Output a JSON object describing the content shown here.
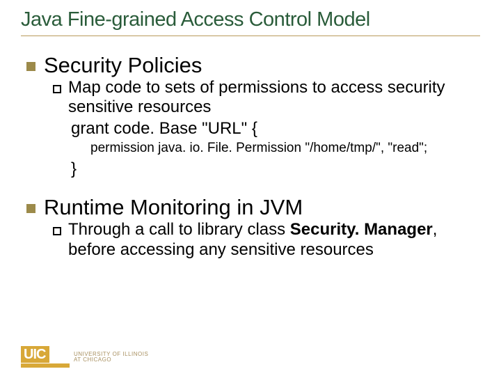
{
  "title": "Java Fine-grained Access Control Model",
  "sections": [
    {
      "heading": "Security Policies",
      "sub": {
        "text": "Map code to sets of permissions to access security sensitive resources",
        "code1": "grant code. Base \"URL\" {",
        "code2": "permission java. io. File. Permission \"/home/tmp/\", \"read\";",
        "code3": "}"
      }
    },
    {
      "heading": "Runtime Monitoring in JVM",
      "sub": {
        "pre": "Through a call to library class ",
        "bold": "Security. Manager",
        "post": ",  before accessing any sensitive resources"
      }
    }
  ],
  "logo": {
    "mark": "UIC",
    "line1": "UNIVERSITY OF ILLINOIS",
    "line2": "AT CHICAGO"
  }
}
